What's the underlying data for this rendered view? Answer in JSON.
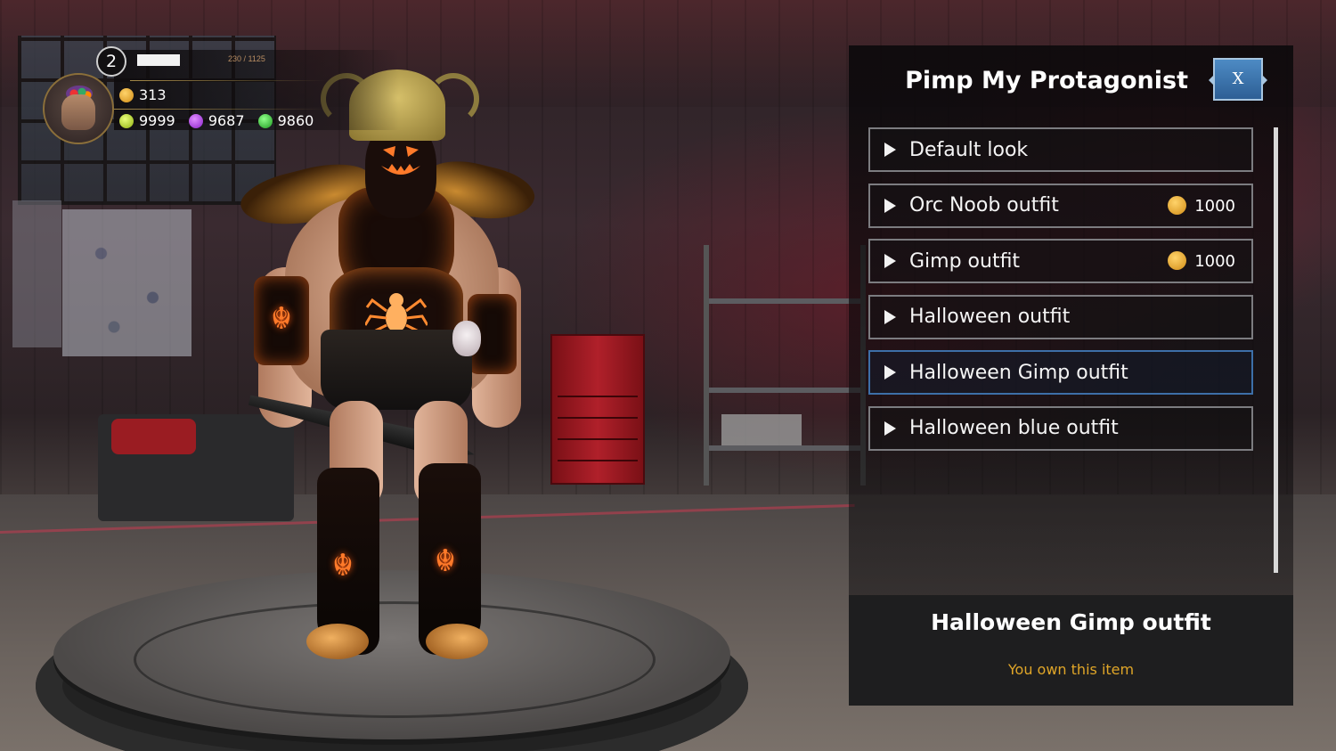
{
  "hud": {
    "level": "2",
    "xp_text": "230 / 1125",
    "xp_progress": 0.204,
    "gold": "313",
    "currencies": [
      {
        "icon": "yellow-gem-icon",
        "value": "9999"
      },
      {
        "icon": "purple-gem-icon",
        "value": "9687"
      },
      {
        "icon": "green-gem-icon",
        "value": "9860"
      }
    ]
  },
  "panel": {
    "title": "Pimp My Protagonist",
    "close_label": "X",
    "items": [
      {
        "label": "Default look",
        "price": ""
      },
      {
        "label": "Orc Noob outfit",
        "price": "1000"
      },
      {
        "label": "Gimp outfit",
        "price": "1000"
      },
      {
        "label": "Halloween outfit",
        "price": ""
      },
      {
        "label": "Halloween Gimp outfit",
        "price": "",
        "selected": true
      },
      {
        "label": "Halloween blue outfit",
        "price": ""
      }
    ],
    "selected_title": "Halloween Gimp outfit",
    "selected_status": "You own this item"
  },
  "colors": {
    "accent_selected": "#3d6fa8",
    "owned_text": "#e0a628",
    "close_button": "#3a73ad"
  }
}
